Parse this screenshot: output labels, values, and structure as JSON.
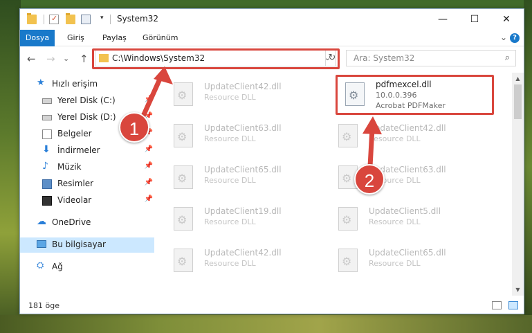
{
  "window": {
    "title": "System32",
    "controls": {
      "minimize": "—",
      "maximize": "☐",
      "close": "✕"
    }
  },
  "quick_access_toolbar": {
    "dropdown": "▾"
  },
  "ribbon": {
    "tabs": [
      "Dosya",
      "Giriş",
      "Paylaş",
      "Görünüm"
    ],
    "expand_chevron": "⌄",
    "help": "?"
  },
  "navbar": {
    "back": "←",
    "forward": "→",
    "recent": "⌄",
    "up": "↑",
    "address": "C:\\Windows\\System32",
    "address_chevron": "⌄",
    "refresh": "↻",
    "search_placeholder": "Ara: System32",
    "search_icon": "⌕"
  },
  "sidebar": {
    "items": [
      {
        "label": "Hızlı erişim",
        "icon": "star-icon",
        "pinned": false
      },
      {
        "label": "Yerel Disk (C:)",
        "icon": "drive-icon",
        "pinned": true
      },
      {
        "label": "Yerel Disk (D:)",
        "icon": "drive-icon",
        "pinned": true
      },
      {
        "label": "Belgeler",
        "icon": "documents-icon",
        "pinned": true
      },
      {
        "label": "İndirmeler",
        "icon": "download-icon",
        "pinned": true
      },
      {
        "label": "Müzik",
        "icon": "music-icon",
        "pinned": true
      },
      {
        "label": "Resimler",
        "icon": "pictures-icon",
        "pinned": true
      },
      {
        "label": "Videolar",
        "icon": "video-icon",
        "pinned": true
      },
      {
        "label": "OneDrive",
        "icon": "cloud-icon",
        "pinned": false
      },
      {
        "label": "Bu bilgisayar",
        "icon": "computer-icon",
        "pinned": false
      },
      {
        "label": "Ağ",
        "icon": "network-icon",
        "pinned": false
      }
    ],
    "pin_glyph": "📌"
  },
  "files": {
    "left_column": [
      {
        "name": "UpdateClient42.dll",
        "type": "Resource DLL"
      },
      {
        "name": "UpdateClient63.dll",
        "type": "Resource DLL"
      },
      {
        "name": "UpdateClient65.dll",
        "type": "Resource DLL"
      },
      {
        "name": "UpdateClient19.dll",
        "type": "Resource DLL"
      },
      {
        "name": "UpdateClient42.dll",
        "type": "Resource DLL"
      }
    ],
    "right_column": [
      {
        "name": "pdfmexcel.dll",
        "version": "10.0.0.396",
        "type": "Acrobat PDFMaker",
        "highlighted": true
      },
      {
        "name": "UpdateClient42.dll",
        "type": "Resource DLL"
      },
      {
        "name": "UpdateClient63.dll",
        "type": "Resource DLL"
      },
      {
        "name": "UpdateClient5.dll",
        "type": "Resource DLL"
      },
      {
        "name": "UpdateClient65.dll",
        "type": "Resource DLL"
      }
    ]
  },
  "scrollbar": {
    "up": "▲",
    "down": "▼"
  },
  "status": {
    "item_count": "181 öge"
  },
  "annotations": {
    "step1": "1",
    "step2": "2",
    "color": "#d9463d"
  }
}
